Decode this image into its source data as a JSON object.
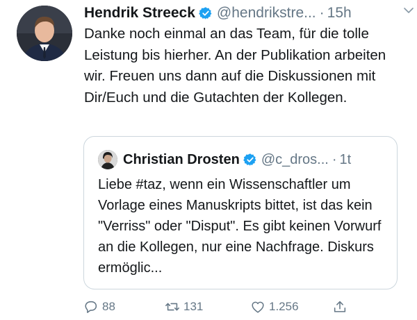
{
  "tweet": {
    "author_name": "Hendrik Streeck",
    "handle": "@hendrikstre...",
    "separator": "·",
    "time": "15h",
    "text": "Danke noch einmal an das Team, für die tolle Leistung bis hierher. An der Publikation arbeiten wir. Freuen uns dann auf die Diskussionen mit Dir/Euch und die Gutachten der Kollegen.",
    "icons": {
      "verified": "verified-badge-icon",
      "more": "chevron-down-icon"
    }
  },
  "quoted_tweet": {
    "author_name": "Christian Drosten",
    "handle": "@c_dros...",
    "separator": "·",
    "time": "1t",
    "text": "Liebe #taz, wenn ein Wissenschaftler um Vorlage eines Manuskripts bittet, ist das kein \"Verriss\" oder \"Disput\". Es gibt keinen Vorwurf an die Kollegen, nur eine Nachfrage. Diskurs ermöglic..."
  },
  "actions": {
    "reply_count": "88",
    "retweet_count": "131",
    "like_count": "1.256",
    "icons": [
      "reply-icon",
      "retweet-icon",
      "like-icon",
      "share-icon"
    ]
  },
  "colors": {
    "verified_blue": "#1da1f2",
    "secondary_text": "#657786",
    "border": "#ccd6dd"
  }
}
